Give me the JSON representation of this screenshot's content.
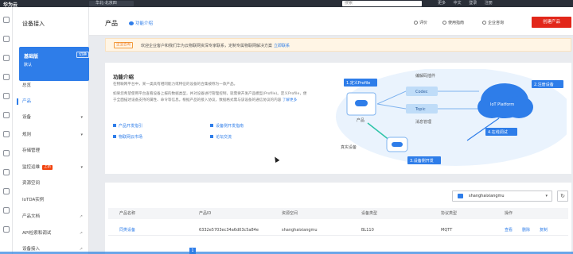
{
  "topbar": {
    "logo": "华为云",
    "region": "华北-北京四",
    "search_placeholder": "搜索",
    "links": [
      "更多",
      "中文",
      "登录",
      "注册"
    ]
  },
  "sidebar": {
    "title": "设备接入",
    "edition_name": "基础版",
    "edition_switch": "切换",
    "edition_sub": "默认",
    "items": [
      {
        "label": "总览"
      },
      {
        "label": "产品",
        "active": true
      },
      {
        "label": "设备",
        "caret": "▾"
      },
      {
        "label": "规则",
        "caret": "▾"
      },
      {
        "label": "存储管理"
      },
      {
        "label": "监控运维",
        "caret": "▾",
        "tag": "上新"
      },
      {
        "label": "资源空间"
      },
      {
        "label": "IoTDA实例"
      },
      {
        "label": "产品文档",
        "link": "↗"
      },
      {
        "label": "API检索和调试",
        "link": "↗"
      },
      {
        "label": "设备接入",
        "link": "↗"
      }
    ]
  },
  "header": {
    "title": "产品",
    "intro_link": "功能介绍",
    "buttons": [
      "评价",
      "使用指南",
      "企业咨询"
    ],
    "create_button": "创建产品"
  },
  "notice": {
    "badge": "企业咨询",
    "text": "欢迎企业客户和我们华为云物联网资深专家联系，定制专属物联网解决方案",
    "link": "立即联系"
  },
  "intro": {
    "title": "功能介绍",
    "desc1": "在物联网平台中，某一类具有相同能力或特征的设备的合集被称为一款产品。",
    "desc2": "如果您希望使用平台查看设备上报的数据类型，并对设备进行管理控制，就需要开发产品模型(Profile)。定义Profile，便于全面描述设备支持的属性、命令等信息。根据产品的接入协议，数据格式需与该设备的通信协议的内容",
    "desc_link": "了解更多",
    "links": [
      "产品开发指引",
      "设备侧开发指南",
      "物联网云市场",
      "论坛交流"
    ]
  },
  "diagram": {
    "step1": "1.定义Profile",
    "step2": "2.注册设备",
    "step3": "3.设备侧开发",
    "step4": "4.在线调试",
    "product": "产品",
    "codec": "Codec",
    "topic": "Topic",
    "codec_top": "编解码插件",
    "topic_bottom": "消息管理",
    "platform": "IoT Platform",
    "real_device": "真实设备"
  },
  "table": {
    "resource_space": "shanghaixiangmu",
    "refresh_icon": "refresh-icon",
    "headers": [
      "产品名称",
      "产品ID",
      "资源空间",
      "设备类型",
      "协议类型",
      "操作"
    ],
    "rows": [
      {
        "name": "同类设备",
        "id": "6332e5703ec34a6d03c5a84e",
        "space": "shanghaixiangmu",
        "type": "BL110",
        "protocol": "MQTT",
        "actions": [
          "查看",
          "删除",
          "复制"
        ]
      }
    ],
    "page": "1"
  },
  "colors": {
    "accent": "#2e7de9",
    "create": "#e2271a",
    "sidebar_edition": "#2e7de9",
    "diagram_bg": "#eaf3fd"
  }
}
